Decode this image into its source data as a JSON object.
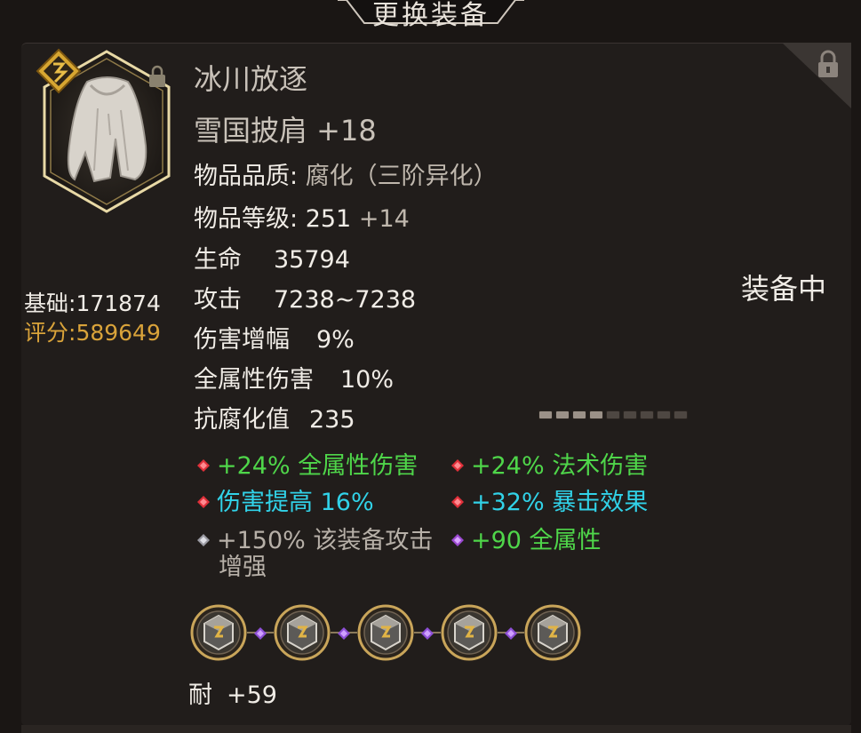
{
  "header": {
    "title": "更换装备"
  },
  "item": {
    "category": "冰川放逐",
    "name": "雪国披肩 +18",
    "icon": "cloak-icon",
    "grade_badge_icon": "rune-badge-icon",
    "locked_icon": "lock-icon"
  },
  "scores": {
    "base_label": "基础:",
    "base_value": "171874",
    "rating_label": "评分:",
    "rating_value": "589649"
  },
  "stats": {
    "quality_label": "物品品质: ",
    "quality_value": "腐化（三阶异化）",
    "level_label": "物品等级: ",
    "level_value": "251",
    "level_bonus": "+14",
    "life_label": "生命",
    "life_value": "35794",
    "attack_label": "攻击",
    "attack_value": "7238~7238",
    "damage_amp_label": "伤害增幅",
    "damage_amp_value": "9%",
    "all_elem_label": "全属性伤害",
    "all_elem_value": "10%",
    "corruption_res_label": "抗腐化值",
    "corruption_res_value": "235"
  },
  "status": {
    "equipped": "装备中"
  },
  "corruption_meter": {
    "segments_total": 9,
    "segments_filled": 4
  },
  "affixes": [
    {
      "text": "+24% 全属性伤害",
      "gem_color": "#e0303a",
      "text_color": "green"
    },
    {
      "text": "+24% 法术伤害",
      "gem_color": "#e0303a",
      "text_color": "green"
    },
    {
      "text": "伤害提高 16%",
      "gem_color": "#e0303a",
      "text_color": "cyan"
    },
    {
      "text": "+32% 暴击效果",
      "gem_color": "#e0303a",
      "text_color": "cyan"
    },
    {
      "text": "+150% 该装备攻击",
      "text_cont": "增强",
      "gem_color": "#b8b8c0",
      "text_color": "grey"
    },
    {
      "text": "+90 全属性",
      "gem_color": "#b060e0",
      "text_color": "green"
    }
  ],
  "sockets": {
    "count": 5,
    "rune_icon": "rune-socket-icon",
    "link_icon": "purple-link-gem-icon"
  },
  "durability": {
    "label": "耐",
    "value": "+59"
  }
}
